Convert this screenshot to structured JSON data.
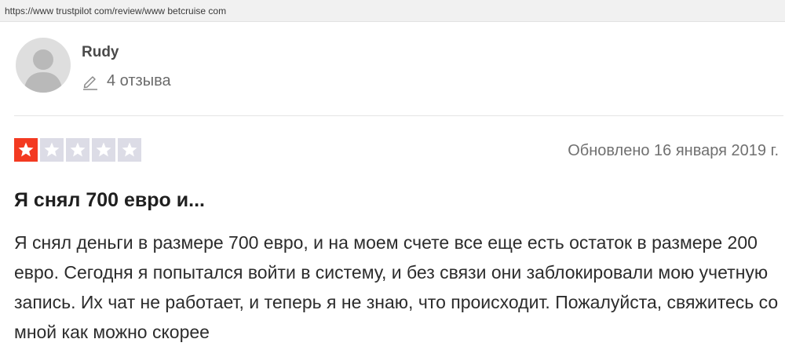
{
  "browser": {
    "url": "https://www trustpilot com/review/www betcruise com"
  },
  "reviewer": {
    "name": "Rudy",
    "reviews_count": "4 отзыва",
    "avatar_icon": "user-silhouette-icon",
    "count_icon": "pencil-icon"
  },
  "review": {
    "rating": 1,
    "rating_max": 5,
    "updated": "Обновлено 16 января 2019 г.",
    "title": "Я снял 700 евро и...",
    "body": "Я снял деньги в размере 700 евро, и на моем счете все еще есть остаток в размере 200 евро. Сегодня я попытался войти в систему, и без связи они заблокировали мою учетную запись. Их чат не работает, и теперь я не знаю, что происходит. Пожалуйста, свяжитесь со мной как можно скорее"
  },
  "colors": {
    "star_active": "#f33a21",
    "star_inactive": "#dcdce6"
  }
}
